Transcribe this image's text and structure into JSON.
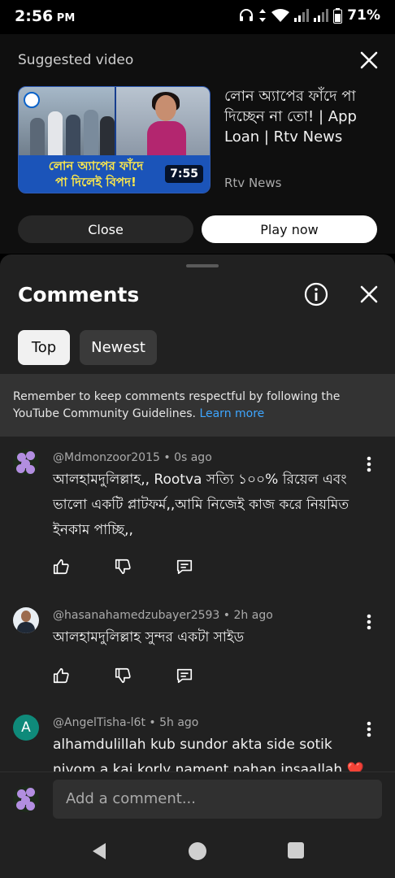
{
  "status_bar": {
    "time": "2:56",
    "ampm": "PM",
    "battery": "71%",
    "icons": [
      "headphones-icon",
      "data-arrows-icon",
      "wifi-icon",
      "signal-icon",
      "signal-icon",
      "battery-icon"
    ]
  },
  "suggested": {
    "heading": "Suggested video",
    "thumbnail": {
      "caption_line1": "লোন অ্যাপের ফাঁদে",
      "caption_line2": "পা দিলেই বিপদ!",
      "duration": "7:55"
    },
    "title": "লোন অ্যাপের ফাঁদে পা দিচ্ছেন না তো! | App Loan | Rtv News",
    "channel": "Rtv News",
    "close_label": "Close",
    "play_label": "Play now"
  },
  "comments_panel": {
    "title": "Comments",
    "chips": [
      "Top",
      "Newest"
    ],
    "guideline_text": "Remember to keep comments respectful by following the YouTube Community Guidelines.",
    "learn_more": "Learn more",
    "comments": [
      {
        "author": "@Mdmonzoor2015",
        "age": "0s ago",
        "text": "আলহামদুলিল্লাহ,, Rootva সত্যি ১০০% রিয়েল এবং ভালো একটি প্লাটফর্ম,,আমি নিজেই কাজ করে নিয়মিত ইনকাম পাচ্ছি,,"
      },
      {
        "author": "@hasanahamedzubayer2593",
        "age": "2h ago",
        "text": "আলহামদুলিল্লাহ সুন্দর একটা সাইড"
      },
      {
        "author": "@AngelTisha-l6t",
        "age": "5h ago",
        "avatar_letter": "A",
        "text": "alhamdulillah kub sundor akta side sotik niyom a kai korly nament pahan insaallah ❤️"
      }
    ],
    "add_comment_placeholder": "Add a comment..."
  },
  "colors": {
    "background": "#212121",
    "accent_link": "#3ea6ff",
    "chip_selected": "#f1f1f1",
    "avatar_letter_bg": "#0f8a7a"
  }
}
